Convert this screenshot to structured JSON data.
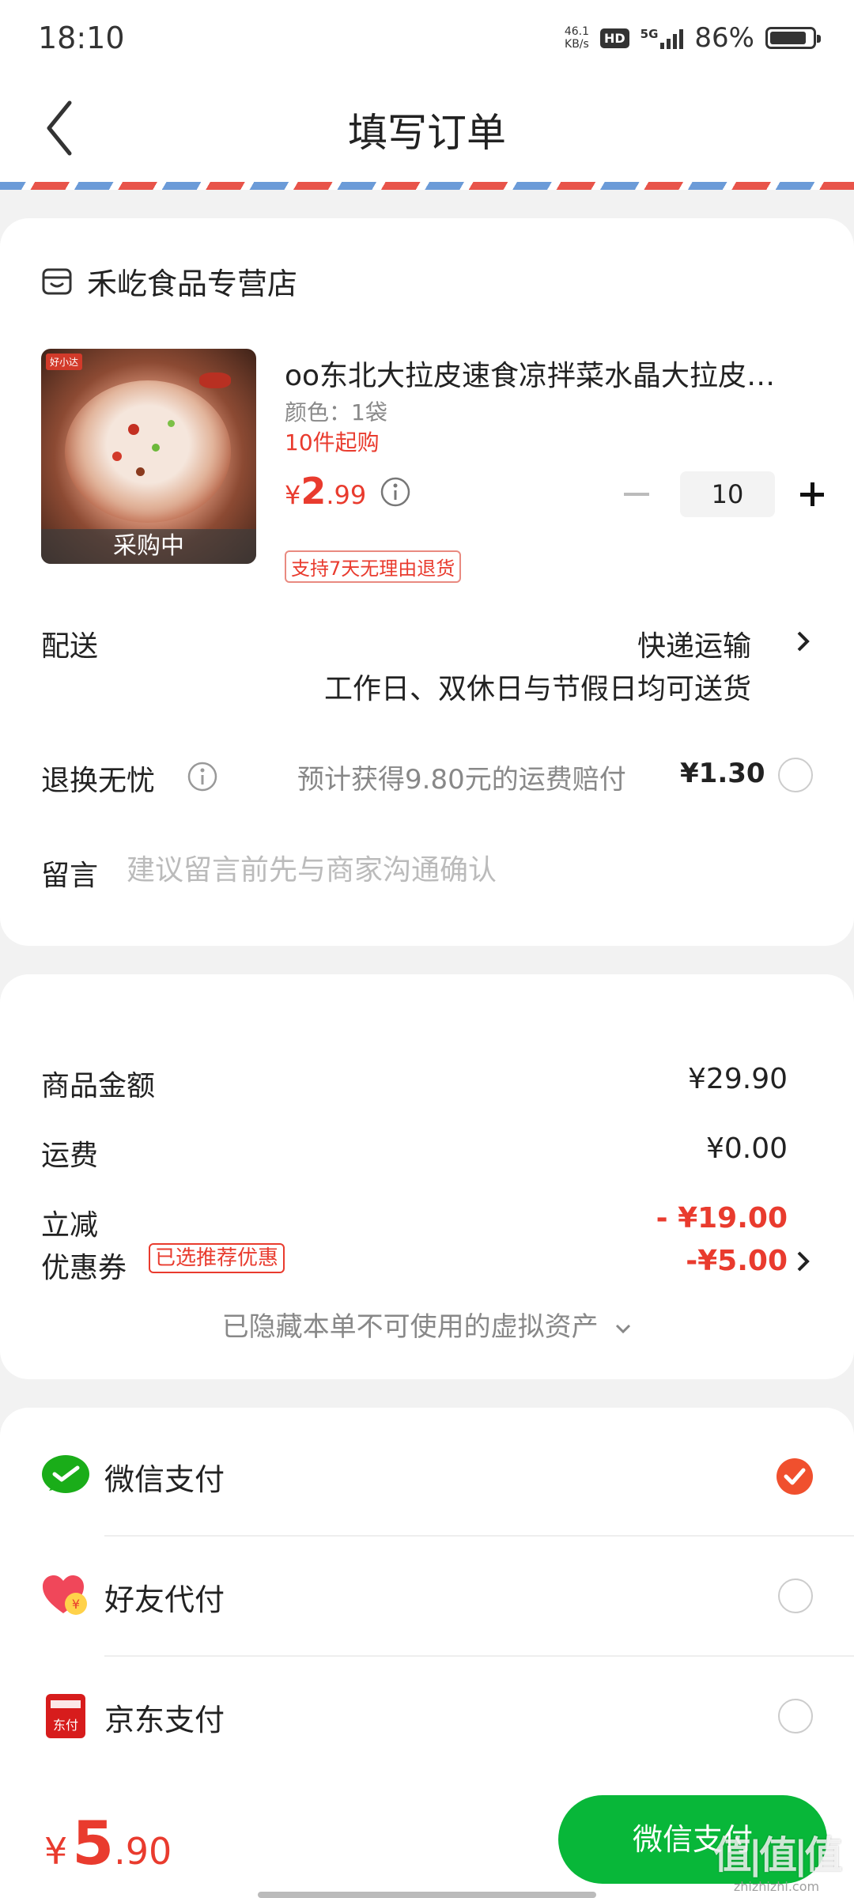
{
  "status_bar": {
    "time": "18:10",
    "net_speed_value": "46.1",
    "net_speed_unit": "KB/s",
    "hd": "HD",
    "network": "5G",
    "battery": "86%",
    "battery_level": 0.86
  },
  "header": {
    "title": "填写订单"
  },
  "shop": {
    "name": "禾屹食品专营店"
  },
  "product": {
    "title": "oo东北大拉皮速食凉拌菜水晶大拉皮东北特色凉菜",
    "spec": "颜色：1袋",
    "min_purchase": "10件起购",
    "price_symbol": "¥",
    "price_int": "2",
    "price_dec": ".99",
    "image_tag": "好小达",
    "image_status": "采购中",
    "quantity": "10",
    "return_policy": "支持7天无理由退货"
  },
  "delivery": {
    "label": "配送",
    "method": "快递运输",
    "note": "工作日、双休日与节假日均可送货"
  },
  "worry_free": {
    "label": "退换无忧",
    "text": "预计获得9.80元的运费赔付",
    "price": "¥1.30"
  },
  "message": {
    "label": "留言",
    "placeholder": "建议留言前先与商家沟通确认"
  },
  "summary": {
    "goods_label": "商品金额",
    "goods_value": "¥29.90",
    "shipping_label": "运费",
    "shipping_value": "¥0.00",
    "discount_label": "立减",
    "discount_value": "- ¥19.00",
    "coupon_label": "优惠券",
    "coupon_tag": "已选推荐优惠",
    "coupon_value": "-¥5.00",
    "hidden_assets": "已隐藏本单不可使用的虚拟资产"
  },
  "payment": {
    "methods": [
      {
        "label": "微信支付",
        "selected": true
      },
      {
        "label": "好友代付",
        "selected": false
      },
      {
        "label": "京东支付",
        "selected": false
      }
    ],
    "jd_icon_text": "东付",
    "friend_icon_text": "¥"
  },
  "footer": {
    "price_symbol": "¥",
    "price_int": "5",
    "price_dec": ".90",
    "pay_button": "微信支付"
  },
  "watermark": {
    "main": "值|值|值",
    "sub": "zhizhizhi.com"
  },
  "colors": {
    "accent_red": "#e93b2e",
    "wechat_green": "#08b739",
    "selected_orange": "#f0502e"
  }
}
